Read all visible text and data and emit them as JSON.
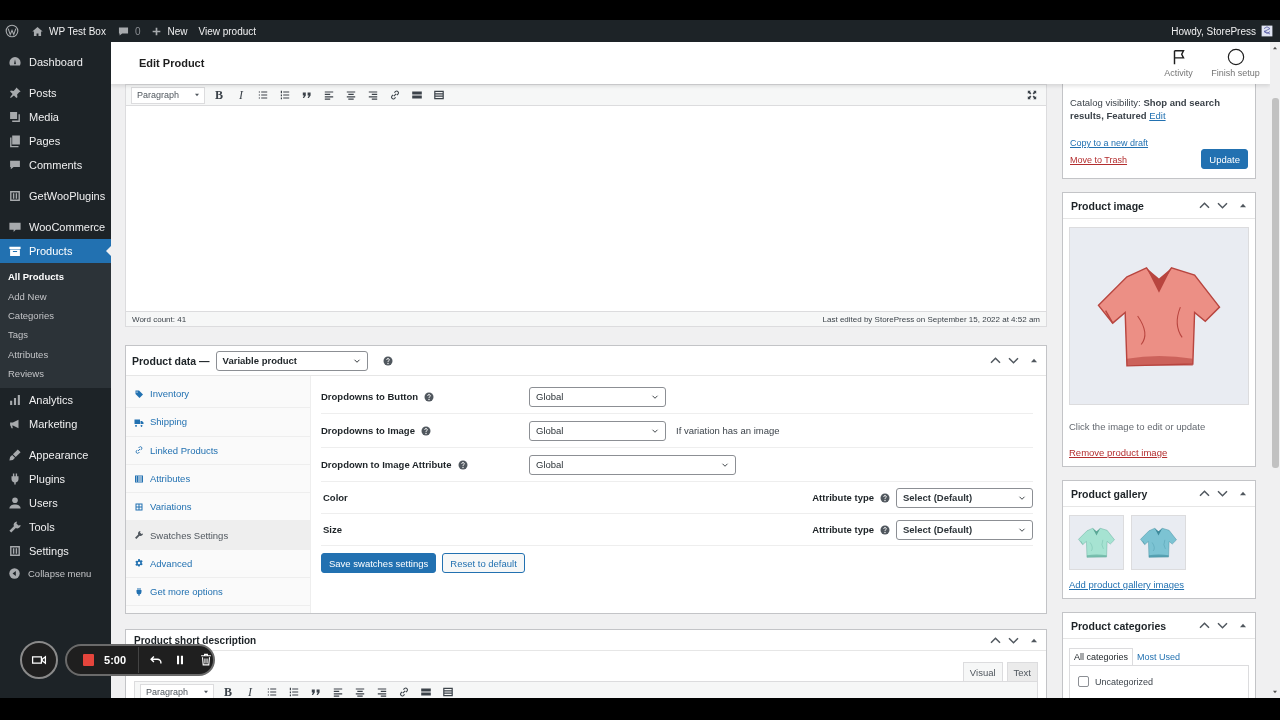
{
  "admin_bar": {
    "site_name": "WP Test Box",
    "comment_count": "0",
    "new_label": "New",
    "view_label": "View product",
    "greeting": "Howdy, StorePress"
  },
  "sidebar": {
    "groups": [
      [
        {
          "label": "Dashboard",
          "selected": false
        }
      ],
      [
        {
          "label": "Posts",
          "selected": false
        },
        {
          "label": "Media",
          "selected": false
        },
        {
          "label": "Pages",
          "selected": false
        },
        {
          "label": "Comments",
          "selected": false
        }
      ],
      [
        {
          "label": "GetWooPlugins",
          "selected": false
        }
      ],
      [
        {
          "label": "WooCommerce",
          "selected": false
        },
        {
          "label": "Products",
          "selected": true,
          "submenu": [
            {
              "label": "All Products",
              "selected": true
            },
            {
              "label": "Add New",
              "selected": false
            },
            {
              "label": "Categories",
              "selected": false
            },
            {
              "label": "Tags",
              "selected": false
            },
            {
              "label": "Attributes",
              "selected": false
            },
            {
              "label": "Reviews",
              "selected": false
            }
          ]
        },
        {
          "label": "Analytics",
          "selected": false
        },
        {
          "label": "Marketing",
          "selected": false
        }
      ],
      [
        {
          "label": "Appearance",
          "selected": false
        },
        {
          "label": "Plugins",
          "selected": false
        },
        {
          "label": "Users",
          "selected": false
        },
        {
          "label": "Tools",
          "selected": false
        },
        {
          "label": "Settings",
          "selected": false
        }
      ]
    ],
    "collapse_label": "Collapse menu"
  },
  "header": {
    "title": "Edit Product",
    "actions": [
      {
        "label": "Activity"
      },
      {
        "label": "Finish setup"
      }
    ]
  },
  "description_editor": {
    "block_format": "Paragraph",
    "format_buttons": [
      "B",
      "I"
    ],
    "word_count": "Word count: 41",
    "last_edited": "Last edited by StorePress on September 15, 2022 at 4:52 am"
  },
  "product_data": {
    "title": "Product data —",
    "product_type": "Variable product",
    "tabs": [
      {
        "label": "Inventory",
        "selected": false
      },
      {
        "label": "Shipping",
        "selected": false
      },
      {
        "label": "Linked Products",
        "selected": false
      },
      {
        "label": "Attributes",
        "selected": false
      },
      {
        "label": "Variations",
        "selected": false
      },
      {
        "label": "Swatches Settings",
        "selected": true
      },
      {
        "label": "Advanced",
        "selected": false
      },
      {
        "label": "Get more options",
        "selected": false
      }
    ],
    "settings": [
      {
        "label": "Dropdowns to Button",
        "value": "Global",
        "kind": "short"
      },
      {
        "label": "Dropdowns to Image",
        "value": "Global",
        "kind": "short",
        "note": "If variation has an image"
      },
      {
        "label": "Dropdown to Image Attribute",
        "value": "Global",
        "kind": "wide"
      }
    ],
    "attributes": [
      {
        "name": "Color",
        "type_label": "Attribute type",
        "value": "Select (Default)"
      },
      {
        "name": "Size",
        "type_label": "Attribute type",
        "value": "Select (Default)"
      }
    ],
    "buttons": [
      {
        "label": "Save swatches settings",
        "kind": "primary"
      },
      {
        "label": "Reset to default",
        "kind": "secondary"
      }
    ]
  },
  "short_description": {
    "title": "Product short description",
    "editor_tabs": [
      {
        "label": "Visual",
        "selected": true
      },
      {
        "label": "Text",
        "selected": false
      }
    ],
    "block_format": "Paragraph",
    "format_buttons": [
      "B",
      "I"
    ]
  },
  "publish": {
    "catalog_visibility": "Catalog visibility: **Shop and search results, Featured**",
    "catalog_edit_link": "Edit",
    "copy_link": "Copy to a new draft",
    "trash_link": "Move to Trash",
    "update_button": "Update"
  },
  "product_image": {
    "title": "Product image",
    "hint": "Click the image to edit or update",
    "remove_link": "Remove product image"
  },
  "product_gallery": {
    "title": "Product gallery",
    "add_link": "Add product gallery images"
  },
  "product_categories": {
    "title": "Product categories",
    "tabs": [
      {
        "label": "All categories",
        "selected": true
      },
      {
        "label": "Most Used",
        "selected": false
      }
    ],
    "items": [
      {
        "label": "Uncategorized",
        "checked": false
      }
    ]
  },
  "recorder": {
    "time": "5:00"
  }
}
